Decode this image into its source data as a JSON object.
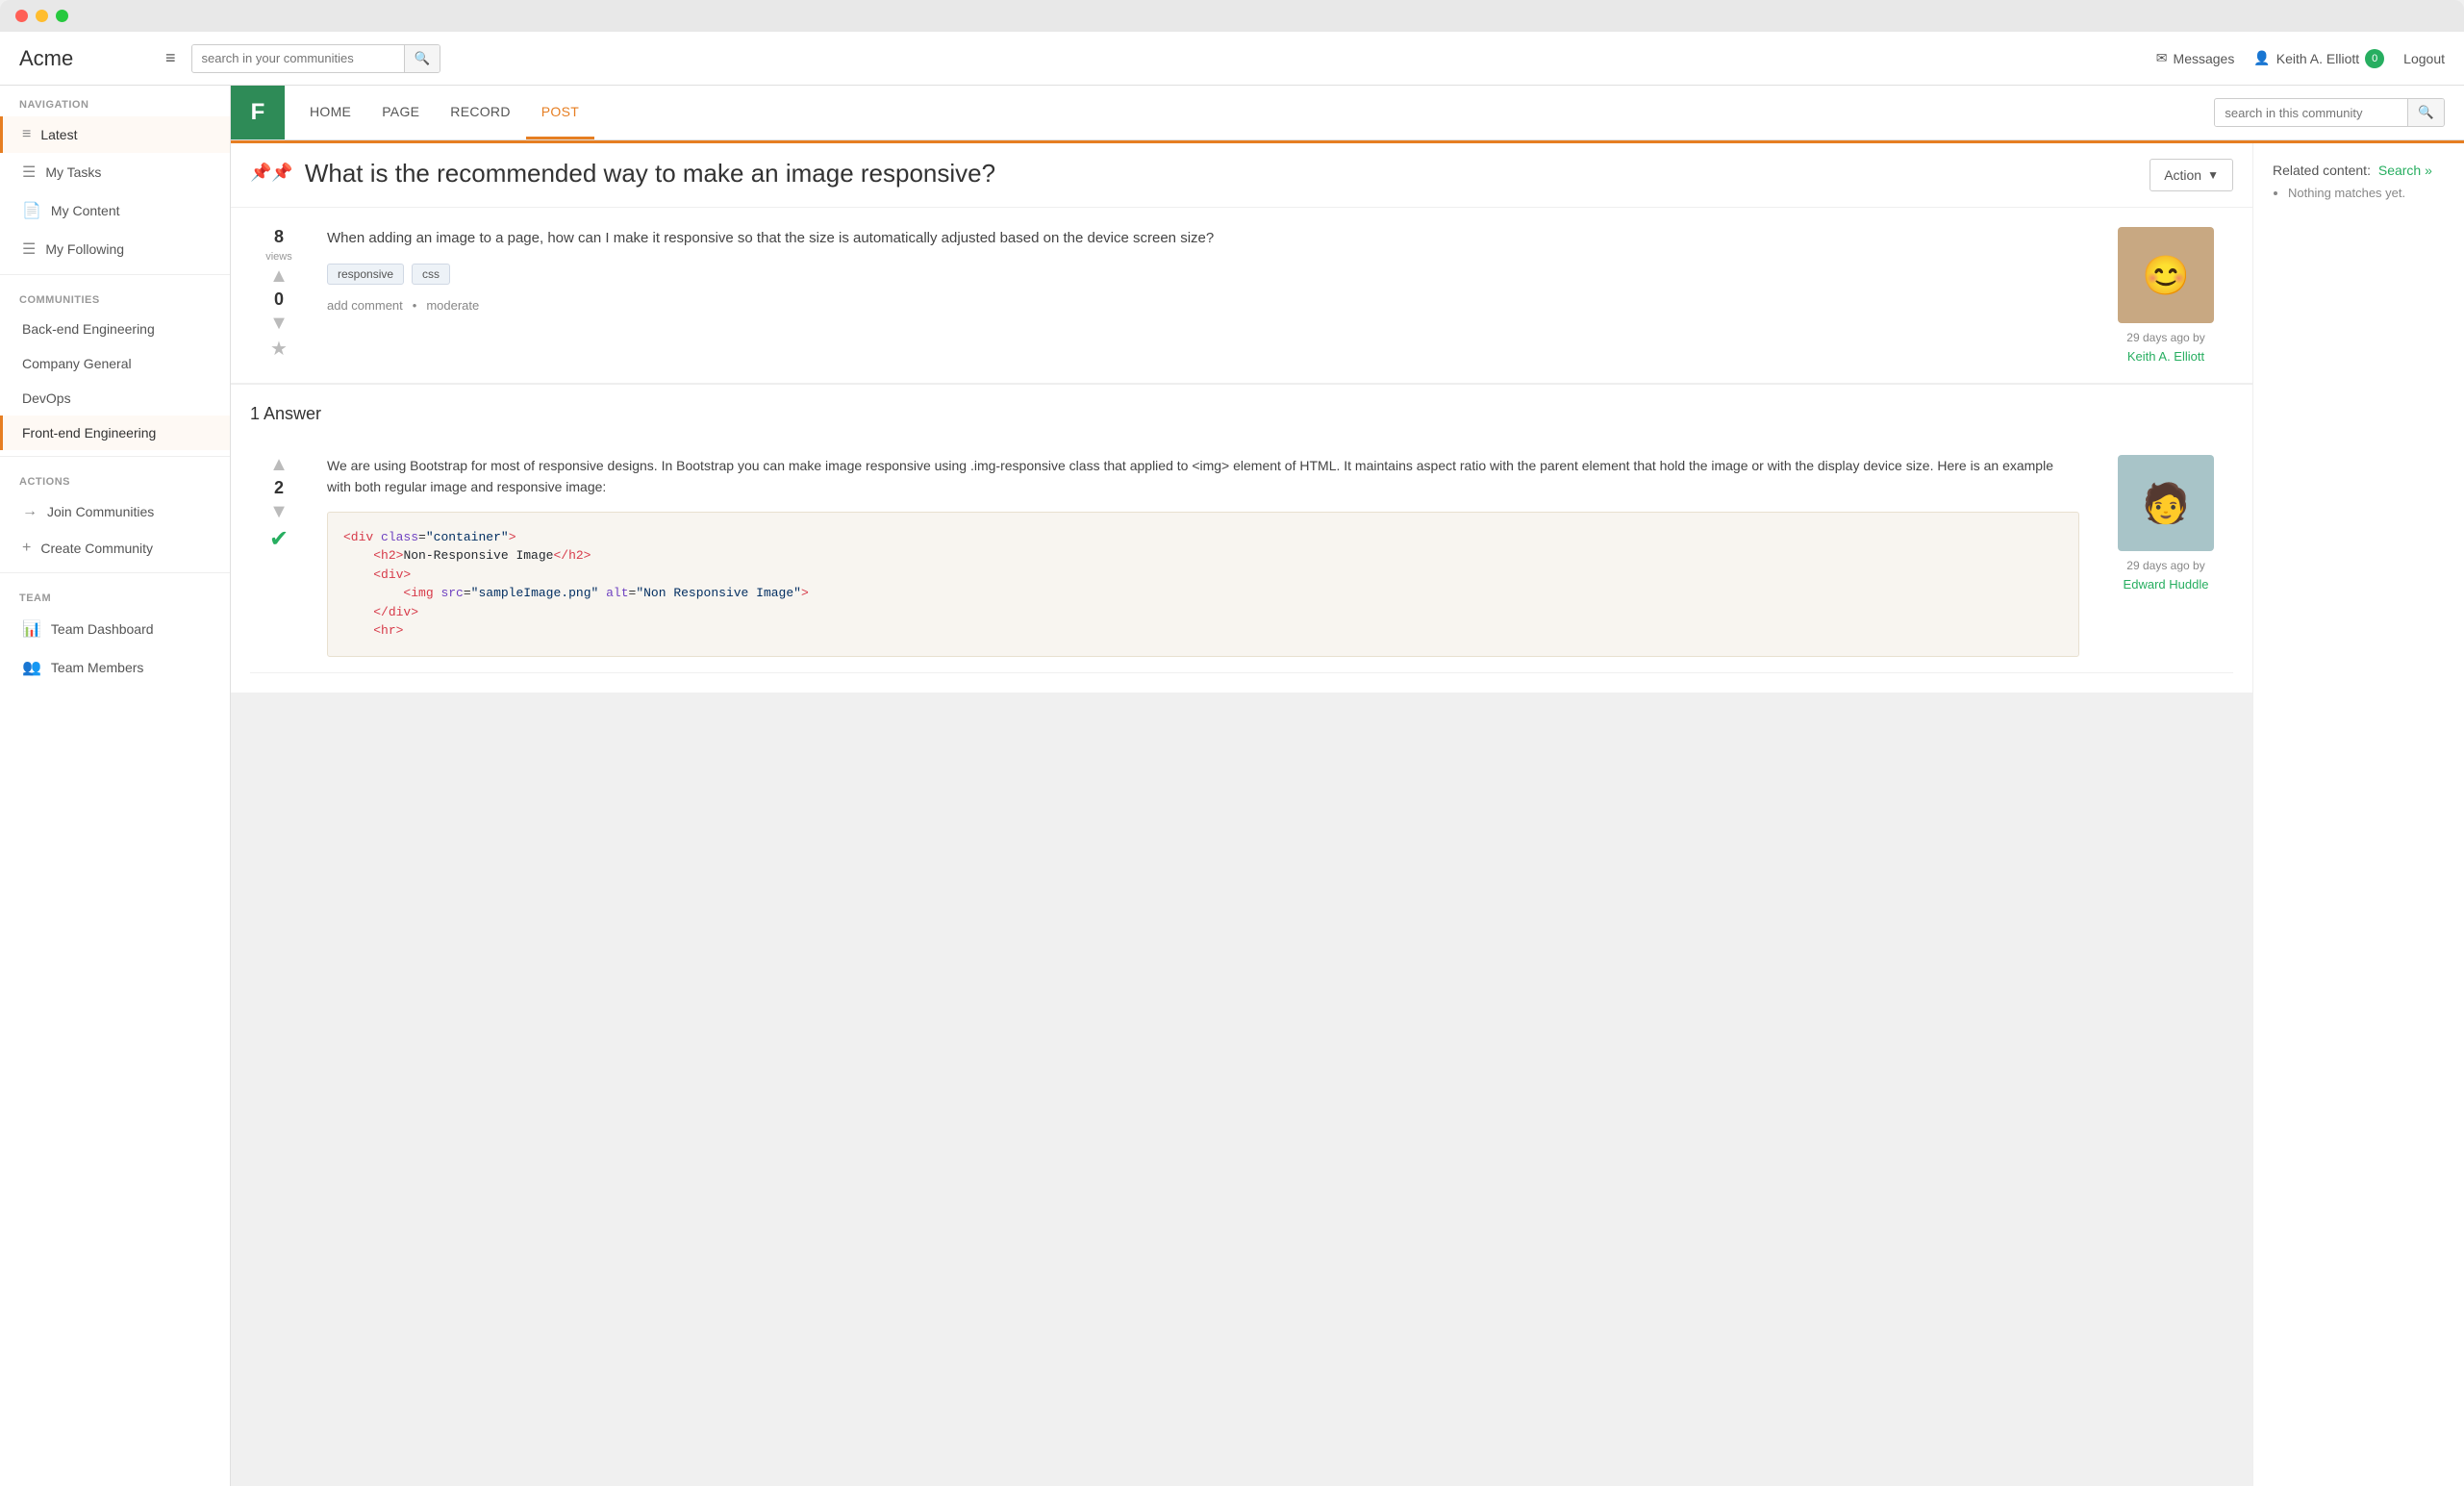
{
  "window": {
    "title": "Acme"
  },
  "topbar": {
    "app_title": "Acme",
    "search_placeholder": "search in your communities",
    "messages_label": "Messages",
    "user_name": "Keith A. Elliott",
    "user_badge": "0",
    "logout_label": "Logout"
  },
  "sidebar": {
    "navigation_title": "NAVIGATION",
    "nav_items": [
      {
        "id": "latest",
        "label": "Latest",
        "icon": "≡",
        "active": true
      },
      {
        "id": "my-tasks",
        "label": "My Tasks",
        "icon": "☰"
      },
      {
        "id": "my-content",
        "label": "My Content",
        "icon": "📄"
      },
      {
        "id": "my-following",
        "label": "My Following",
        "icon": "☰"
      }
    ],
    "communities_title": "COMMUNITIES",
    "communities": [
      {
        "id": "backend-engineering",
        "label": "Back-end Engineering",
        "active": false
      },
      {
        "id": "company-general",
        "label": "Company General",
        "active": false
      },
      {
        "id": "devops",
        "label": "DevOps",
        "active": false
      },
      {
        "id": "frontend-engineering",
        "label": "Front-end Engineering",
        "active": true
      }
    ],
    "actions_title": "ACTIONS",
    "actions": [
      {
        "id": "join-communities",
        "label": "Join Communities",
        "icon": "→"
      },
      {
        "id": "create-community",
        "label": "Create Community",
        "icon": "+"
      }
    ],
    "team_title": "TEAM",
    "team_items": [
      {
        "id": "team-dashboard",
        "label": "Team Dashboard",
        "icon": "📊"
      },
      {
        "id": "team-members",
        "label": "Team Members",
        "icon": "👥"
      }
    ]
  },
  "community_header": {
    "logo_letter": "F",
    "tabs": [
      {
        "id": "home",
        "label": "HOME",
        "active": false
      },
      {
        "id": "page",
        "label": "PAGE",
        "active": false
      },
      {
        "id": "record",
        "label": "RECORD",
        "active": false
      },
      {
        "id": "post",
        "label": "POST",
        "active": true
      }
    ],
    "search_placeholder": "search in this community"
  },
  "post": {
    "title": "What is the recommended way to make an image responsive?",
    "action_label": "Action",
    "views_count": "8",
    "views_label": "views",
    "vote_count": "0",
    "question_text": "When adding an image to a page, how can I make it responsive so that the size is automatically adjusted based on the device screen size?",
    "tags": [
      "responsive",
      "css"
    ],
    "add_comment_label": "add comment",
    "moderate_label": "moderate",
    "post_date": "29 days ago by",
    "author_name": "Keith A. Elliott"
  },
  "related": {
    "title": "Related content:",
    "search_label": "Search »",
    "no_match": "Nothing matches yet."
  },
  "answers": {
    "count_label": "1 Answer",
    "items": [
      {
        "vote_count": "2",
        "accepted": true,
        "text": "We are using Bootstrap for most of responsive designs. In Bootstrap you can make image responsive using .img-responsive class that applied to <img> element of HTML. It maintains aspect ratio with the parent element that hold the image or with the display device size. Here is an example with both regular image and responsive image:",
        "post_date": "29 days ago by",
        "author_name": "Edward Huddle",
        "code": "<div class=\"container\">\n    <h2>Non-Responsive Image</h2>\n    <div>\n        <img src=\"sampleImage.png\" alt=\"Non Responsive Image\">\n    </div>\n    <hr>"
      }
    ]
  }
}
